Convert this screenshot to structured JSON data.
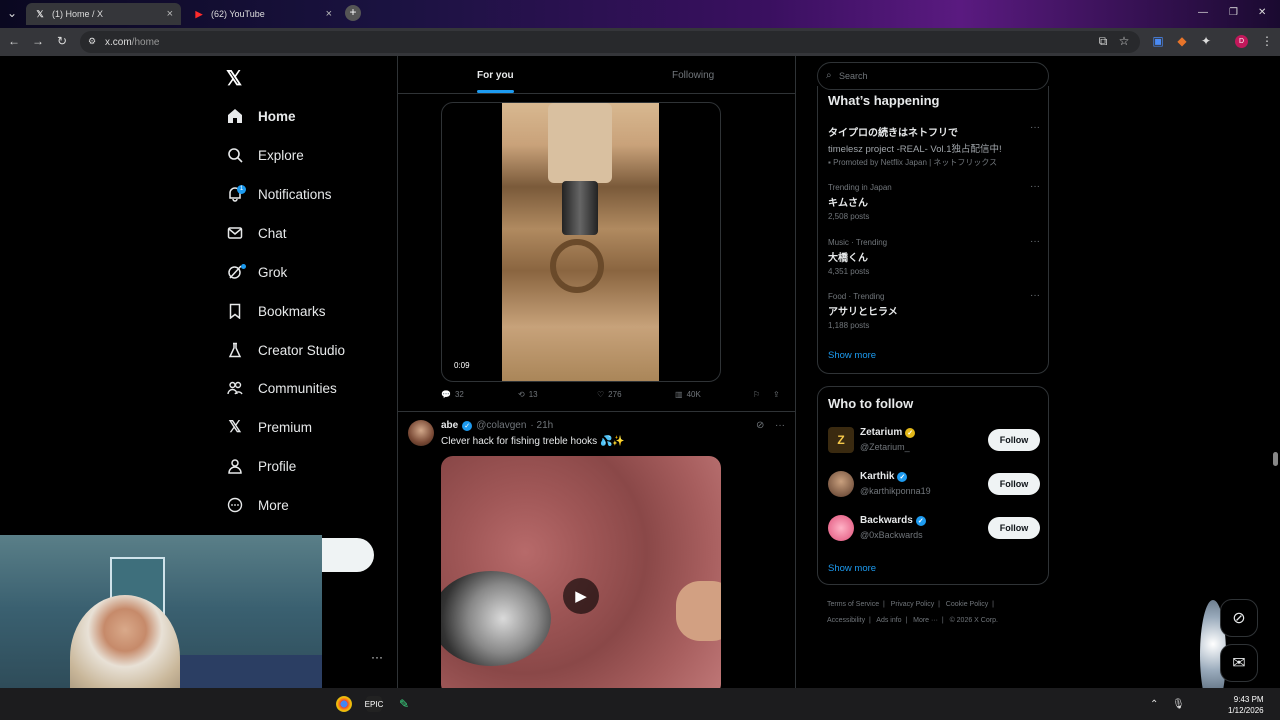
{
  "browser": {
    "tabs": [
      {
        "title": "(1) Home / X",
        "active": true
      },
      {
        "title": "(62) YouTube",
        "active": false
      }
    ],
    "url_host": "x.com",
    "url_path": "/home",
    "profile_initial": "D"
  },
  "sidebar": {
    "logo": "𝕏",
    "items": [
      {
        "label": "Home",
        "icon": "home-icon",
        "active": true
      },
      {
        "label": "Explore",
        "icon": "search-icon"
      },
      {
        "label": "Notifications",
        "icon": "bell-icon",
        "badge": "1"
      },
      {
        "label": "Chat",
        "icon": "mail-icon"
      },
      {
        "label": "Grok",
        "icon": "grok-icon"
      },
      {
        "label": "Bookmarks",
        "icon": "bookmark-icon"
      },
      {
        "label": "Creator Studio",
        "icon": "flask-icon"
      },
      {
        "label": "Communities",
        "icon": "people-icon"
      },
      {
        "label": "Premium",
        "icon": "x-logo-icon"
      },
      {
        "label": "Profile",
        "icon": "person-icon"
      },
      {
        "label": "More",
        "icon": "more-circle-icon"
      }
    ]
  },
  "feed": {
    "tabs": [
      {
        "label": "For you",
        "active": true
      },
      {
        "label": "Following",
        "active": false
      }
    ],
    "post1": {
      "video_time": "0:09",
      "replies": "32",
      "reposts": "13",
      "likes": "276",
      "views": "40K"
    },
    "post2": {
      "name": "abe",
      "handle": "@colavgen",
      "time": "· 21h",
      "text": "Clever hack for fishing treble hooks 💦✨"
    }
  },
  "search": {
    "placeholder": "Search"
  },
  "happening": {
    "title": "What’s happening",
    "trends": [
      {
        "category": "",
        "name": "タイプロの続きはネトフリで",
        "desc": "timelesz project -REAL- Vol.1独占配信中!",
        "promo": "Promoted by Netflix Japan | ネットフリックス"
      },
      {
        "category": "Trending in Japan",
        "name": "キムさん",
        "posts": "2,508 posts"
      },
      {
        "category": "Music · Trending",
        "name": "大橋くん",
        "posts": "4,351 posts"
      },
      {
        "category": "Food · Trending",
        "name": "アサリとヒラメ",
        "posts": "1,188 posts"
      }
    ],
    "show_more": "Show more"
  },
  "who_to_follow": {
    "title": "Who to follow",
    "users": [
      {
        "name": "Zetarium",
        "handle": "@Zetarium_",
        "verified_color": "#e2b719",
        "button": "Follow"
      },
      {
        "name": "Karthik",
        "handle": "@karthikponna19",
        "verified_color": "#1d9bf0",
        "button": "Follow"
      },
      {
        "name": "Backwards",
        "handle": "@0xBackwards",
        "verified_color": "#1d9bf0",
        "button": "Follow"
      }
    ],
    "show_more": "Show more"
  },
  "footer": {
    "line1": [
      "Terms of Service",
      "Privacy Policy",
      "Cookie Policy"
    ],
    "line2": [
      "Accessibility",
      "Ads info",
      "More ···",
      "© 2026 X Corp."
    ]
  },
  "taskbar": {
    "time": "9:43 PM",
    "date": "1/12/2026"
  },
  "colors": {
    "accent": "#1d9bf0",
    "background": "#000000"
  }
}
